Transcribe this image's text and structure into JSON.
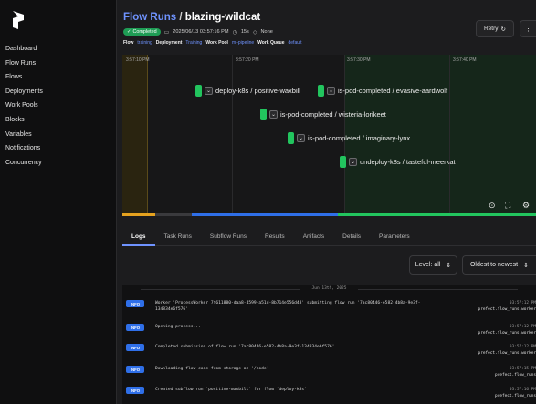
{
  "sidebar": {
    "items": [
      {
        "label": "Dashboard"
      },
      {
        "label": "Flow Runs"
      },
      {
        "label": "Flows"
      },
      {
        "label": "Deployments"
      },
      {
        "label": "Work Pools"
      },
      {
        "label": "Blocks"
      },
      {
        "label": "Variables"
      },
      {
        "label": "Notifications"
      },
      {
        "label": "Concurrency"
      }
    ]
  },
  "header": {
    "breadcrumb": "Flow Runs",
    "separator": "/",
    "run_name": "blazing-wildcat",
    "status": "Completed",
    "timestamp": "2025/06/13 03:57:16 PM",
    "duration": "15s",
    "tags": "None",
    "info": {
      "flow_label": "Flow",
      "flow_value": "training",
      "deployment_label": "Deployment",
      "deployment_value": "Training",
      "work_pool_label": "Work Pool",
      "work_pool_value": "ml-pipeline",
      "work_queue_label": "Work Queue",
      "work_queue_value": "default"
    },
    "retry_label": "Retry",
    "kebab_label": "⋮"
  },
  "timeline": {
    "times": [
      "3:57:10 PM",
      "3:57:20 PM",
      "3:57:30 PM",
      "3:57:40 PM"
    ],
    "nodes": [
      {
        "label": "deploy-k8s / positive-waxbill"
      },
      {
        "label": "is-pod-completed / evasive-aardwolf"
      },
      {
        "label": "is-pod-completed / wisteria-lorikeet"
      },
      {
        "label": "is-pod-completed / imaginary-lynx"
      },
      {
        "label": "undeploy-k8s / tasteful-meerkat"
      }
    ],
    "colors": {
      "completed": "#22c55e",
      "running": "#e5a21f"
    }
  },
  "tabs": [
    {
      "label": "Logs"
    },
    {
      "label": "Task Runs"
    },
    {
      "label": "Subflow Runs"
    },
    {
      "label": "Results"
    },
    {
      "label": "Artifacts"
    },
    {
      "label": "Details"
    },
    {
      "label": "Parameters"
    }
  ],
  "filters": {
    "level": "Level: all",
    "order": "Oldest to newest"
  },
  "logs": {
    "date": "Jun 13th, 2025",
    "rows": [
      {
        "level": "INFO",
        "message": "Worker 'ProcessWorker 7f611880-daa8-4599-a51d-8b714e556d48' submitting flow run '7ac80446-e582-4b8a-9e3f-134834e6f576'",
        "time": "03:57:12 PM",
        "logger": "prefect.flow_runs.worker"
      },
      {
        "level": "INFO",
        "message": "Opening process...",
        "time": "03:57:12 PM",
        "logger": "prefect.flow_runs.worker"
      },
      {
        "level": "INFO",
        "message": "Completed submission of flow run '7ac80446-e582-4b8a-9e3f-134834e6f576'",
        "time": "03:57:12 PM",
        "logger": "prefect.flow_runs.worker"
      },
      {
        "level": "INFO",
        "message": "Downloading flow code from storage at '/code'",
        "time": "03:57:15 PM",
        "logger": "prefect.flow_runs"
      },
      {
        "level": "INFO",
        "message": "Created subflow run 'positive-waxbill' for flow 'deploy-k8s'",
        "time": "03:57:16 PM",
        "logger": "prefect.flow_runs"
      }
    ]
  }
}
